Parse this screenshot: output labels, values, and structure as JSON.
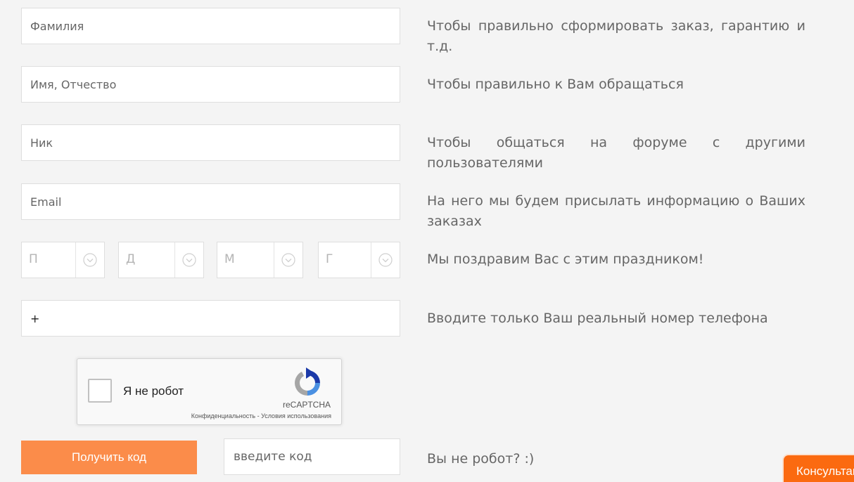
{
  "fields": {
    "surname": {
      "placeholder": "Фамилия",
      "hint": "Чтобы правильно сформировать заказ, гарантию и т.д."
    },
    "name": {
      "placeholder": "Имя, Отчество",
      "hint": "Чтобы правильно к Вам обращаться"
    },
    "nick": {
      "placeholder": "Ник",
      "hint": "Чтобы общаться на форуме с другими пользователями"
    },
    "email": {
      "placeholder": "Email",
      "hint": "На него мы будем присылать информацию о Ваших заказах"
    },
    "phone": {
      "value": "+",
      "hint": "Вводите только Ваш реальный номер телефона"
    }
  },
  "birthday": {
    "hint": "Мы поздравим Вас с этим праздником!",
    "weekday": "П",
    "day": "Д",
    "month": "М",
    "year": "Г",
    "arrow_icon": "chevron-down-circle-icon"
  },
  "recaptcha": {
    "label": "Я не робот",
    "brand": "reCAPTCHA",
    "privacy": "Конфиденциальность",
    "separator": "-",
    "terms": "Условия использования",
    "logo_icon": "recaptcha-logo-icon"
  },
  "code": {
    "button_label": "Получить код",
    "placeholder": "введите код",
    "hint": "Вы не робот? :)"
  },
  "consult_label": "Консультант",
  "colors": {
    "accent_button": "#fb8c4a",
    "consult_tab": "#fb6a10"
  }
}
